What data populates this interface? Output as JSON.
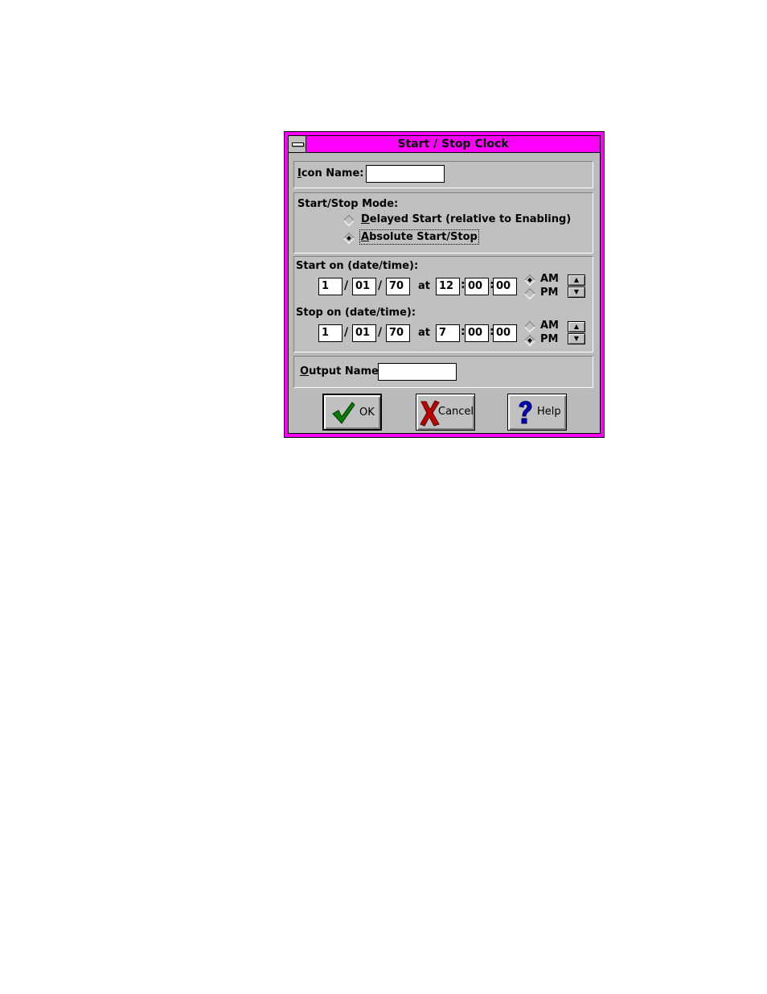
{
  "window": {
    "title": "Start / Stop Clock"
  },
  "icon_name": {
    "label": "Icon Name:",
    "value": ""
  },
  "mode": {
    "label": "Start/Stop Mode:",
    "options": [
      {
        "label": "Delayed Start (relative to Enabling)",
        "selected": false
      },
      {
        "label": "Absolute Start/Stop",
        "selected": true
      }
    ]
  },
  "start": {
    "label": "Start on (date/time):",
    "month": "1",
    "day": "01",
    "year": "70",
    "at": "at",
    "hour": "12",
    "minute": "00",
    "second": "00",
    "am_label": "AM",
    "pm_label": "PM",
    "ampm_selected": "AM"
  },
  "stop": {
    "label": "Stop on (date/time):",
    "month": "1",
    "day": "01",
    "year": "70",
    "at": "at",
    "hour": "7",
    "minute": "00",
    "second": "00",
    "am_label": "AM",
    "pm_label": "PM",
    "ampm_selected": "PM"
  },
  "output_name": {
    "label": "Output Name:",
    "value": ""
  },
  "separators": {
    "date": "/",
    "time": ":"
  },
  "buttons": {
    "ok": "OK",
    "cancel": "Cancel",
    "help": "Help"
  },
  "colors": {
    "titlebar": "#ff00ff",
    "face": "#c0c0c0",
    "ok_check": "#008000",
    "cancel_x": "#c00000",
    "help_q": "#0000c0"
  }
}
